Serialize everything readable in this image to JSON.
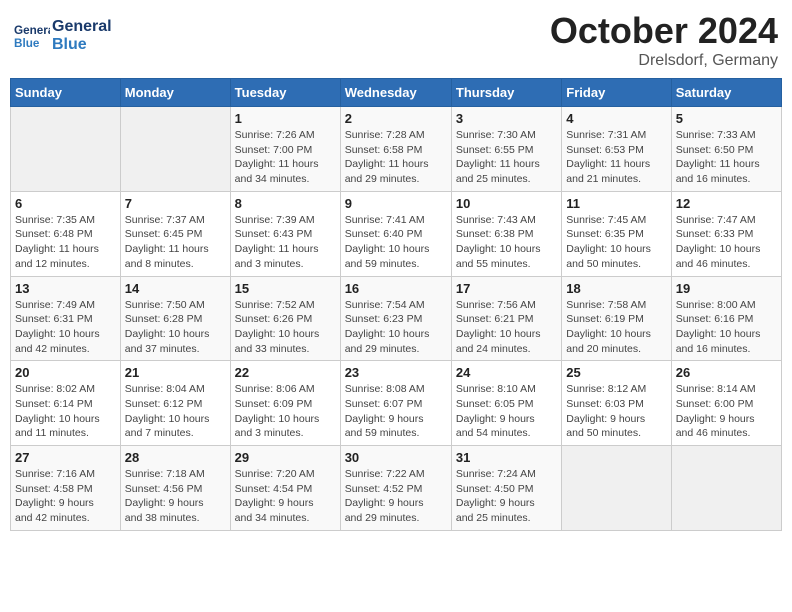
{
  "header": {
    "logo_line1": "General",
    "logo_line2": "Blue",
    "month_title": "October 2024",
    "location": "Drelsdorf, Germany"
  },
  "weekdays": [
    "Sunday",
    "Monday",
    "Tuesday",
    "Wednesday",
    "Thursday",
    "Friday",
    "Saturday"
  ],
  "weeks": [
    [
      {
        "day": "",
        "info": ""
      },
      {
        "day": "",
        "info": ""
      },
      {
        "day": "1",
        "info": "Sunrise: 7:26 AM\nSunset: 7:00 PM\nDaylight: 11 hours\nand 34 minutes."
      },
      {
        "day": "2",
        "info": "Sunrise: 7:28 AM\nSunset: 6:58 PM\nDaylight: 11 hours\nand 29 minutes."
      },
      {
        "day": "3",
        "info": "Sunrise: 7:30 AM\nSunset: 6:55 PM\nDaylight: 11 hours\nand 25 minutes."
      },
      {
        "day": "4",
        "info": "Sunrise: 7:31 AM\nSunset: 6:53 PM\nDaylight: 11 hours\nand 21 minutes."
      },
      {
        "day": "5",
        "info": "Sunrise: 7:33 AM\nSunset: 6:50 PM\nDaylight: 11 hours\nand 16 minutes."
      }
    ],
    [
      {
        "day": "6",
        "info": "Sunrise: 7:35 AM\nSunset: 6:48 PM\nDaylight: 11 hours\nand 12 minutes."
      },
      {
        "day": "7",
        "info": "Sunrise: 7:37 AM\nSunset: 6:45 PM\nDaylight: 11 hours\nand 8 minutes."
      },
      {
        "day": "8",
        "info": "Sunrise: 7:39 AM\nSunset: 6:43 PM\nDaylight: 11 hours\nand 3 minutes."
      },
      {
        "day": "9",
        "info": "Sunrise: 7:41 AM\nSunset: 6:40 PM\nDaylight: 10 hours\nand 59 minutes."
      },
      {
        "day": "10",
        "info": "Sunrise: 7:43 AM\nSunset: 6:38 PM\nDaylight: 10 hours\nand 55 minutes."
      },
      {
        "day": "11",
        "info": "Sunrise: 7:45 AM\nSunset: 6:35 PM\nDaylight: 10 hours\nand 50 minutes."
      },
      {
        "day": "12",
        "info": "Sunrise: 7:47 AM\nSunset: 6:33 PM\nDaylight: 10 hours\nand 46 minutes."
      }
    ],
    [
      {
        "day": "13",
        "info": "Sunrise: 7:49 AM\nSunset: 6:31 PM\nDaylight: 10 hours\nand 42 minutes."
      },
      {
        "day": "14",
        "info": "Sunrise: 7:50 AM\nSunset: 6:28 PM\nDaylight: 10 hours\nand 37 minutes."
      },
      {
        "day": "15",
        "info": "Sunrise: 7:52 AM\nSunset: 6:26 PM\nDaylight: 10 hours\nand 33 minutes."
      },
      {
        "day": "16",
        "info": "Sunrise: 7:54 AM\nSunset: 6:23 PM\nDaylight: 10 hours\nand 29 minutes."
      },
      {
        "day": "17",
        "info": "Sunrise: 7:56 AM\nSunset: 6:21 PM\nDaylight: 10 hours\nand 24 minutes."
      },
      {
        "day": "18",
        "info": "Sunrise: 7:58 AM\nSunset: 6:19 PM\nDaylight: 10 hours\nand 20 minutes."
      },
      {
        "day": "19",
        "info": "Sunrise: 8:00 AM\nSunset: 6:16 PM\nDaylight: 10 hours\nand 16 minutes."
      }
    ],
    [
      {
        "day": "20",
        "info": "Sunrise: 8:02 AM\nSunset: 6:14 PM\nDaylight: 10 hours\nand 11 minutes."
      },
      {
        "day": "21",
        "info": "Sunrise: 8:04 AM\nSunset: 6:12 PM\nDaylight: 10 hours\nand 7 minutes."
      },
      {
        "day": "22",
        "info": "Sunrise: 8:06 AM\nSunset: 6:09 PM\nDaylight: 10 hours\nand 3 minutes."
      },
      {
        "day": "23",
        "info": "Sunrise: 8:08 AM\nSunset: 6:07 PM\nDaylight: 9 hours\nand 59 minutes."
      },
      {
        "day": "24",
        "info": "Sunrise: 8:10 AM\nSunset: 6:05 PM\nDaylight: 9 hours\nand 54 minutes."
      },
      {
        "day": "25",
        "info": "Sunrise: 8:12 AM\nSunset: 6:03 PM\nDaylight: 9 hours\nand 50 minutes."
      },
      {
        "day": "26",
        "info": "Sunrise: 8:14 AM\nSunset: 6:00 PM\nDaylight: 9 hours\nand 46 minutes."
      }
    ],
    [
      {
        "day": "27",
        "info": "Sunrise: 7:16 AM\nSunset: 4:58 PM\nDaylight: 9 hours\nand 42 minutes."
      },
      {
        "day": "28",
        "info": "Sunrise: 7:18 AM\nSunset: 4:56 PM\nDaylight: 9 hours\nand 38 minutes."
      },
      {
        "day": "29",
        "info": "Sunrise: 7:20 AM\nSunset: 4:54 PM\nDaylight: 9 hours\nand 34 minutes."
      },
      {
        "day": "30",
        "info": "Sunrise: 7:22 AM\nSunset: 4:52 PM\nDaylight: 9 hours\nand 29 minutes."
      },
      {
        "day": "31",
        "info": "Sunrise: 7:24 AM\nSunset: 4:50 PM\nDaylight: 9 hours\nand 25 minutes."
      },
      {
        "day": "",
        "info": ""
      },
      {
        "day": "",
        "info": ""
      }
    ]
  ]
}
